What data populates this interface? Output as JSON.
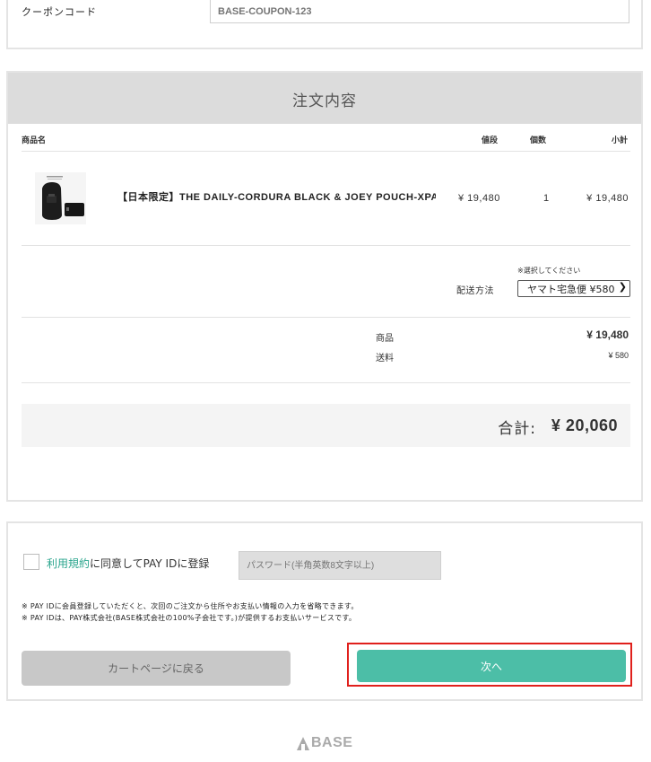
{
  "coupon": {
    "label": "クーポンコード",
    "placeholder": "BASE-COUPON-123"
  },
  "order": {
    "title": "注文内容",
    "columns": {
      "name": "商品名",
      "price": "値段",
      "qty": "個数",
      "subtotal": "小計"
    },
    "item": {
      "name": "【日本限定】THE DAILY-CORDURA BLACK & JOEY POUCH-XPAC",
      "price": "¥ 19,480",
      "qty": "1",
      "subtotal": "¥ 19,480",
      "thumbnail_icon": "product-thumbnail"
    },
    "shipping": {
      "note": "※選択してください",
      "label": "配送方法",
      "selected": "ヤマト宅急便 ¥580"
    },
    "summary": {
      "items_label": "商品",
      "items_value": "¥ 19,480",
      "shipping_label": "送料",
      "shipping_value": "¥ 580"
    },
    "total": {
      "label": "合計:",
      "value": "¥ 20,060"
    }
  },
  "register": {
    "terms_link": "利用規約",
    "agree_text": "に同意してPAY IDに登録",
    "password_placeholder": "パスワード(半角英数8文字以上)",
    "note1": "※ PAY IDに会員登録していただくと、次回のご注文から住所やお支払い情報の入力を省略できます。",
    "note2": "※ PAY IDは、PAY株式会社(BASE株式会社の100%子会社です。)が提供するお支払いサービスです。",
    "back_label": "カートページに戻る",
    "next_label": "次へ"
  },
  "footer": {
    "logo_text": "BASE"
  },
  "colors": {
    "accent": "#4cbea7",
    "highlight": "#e0201c",
    "link": "#2aa58d"
  }
}
